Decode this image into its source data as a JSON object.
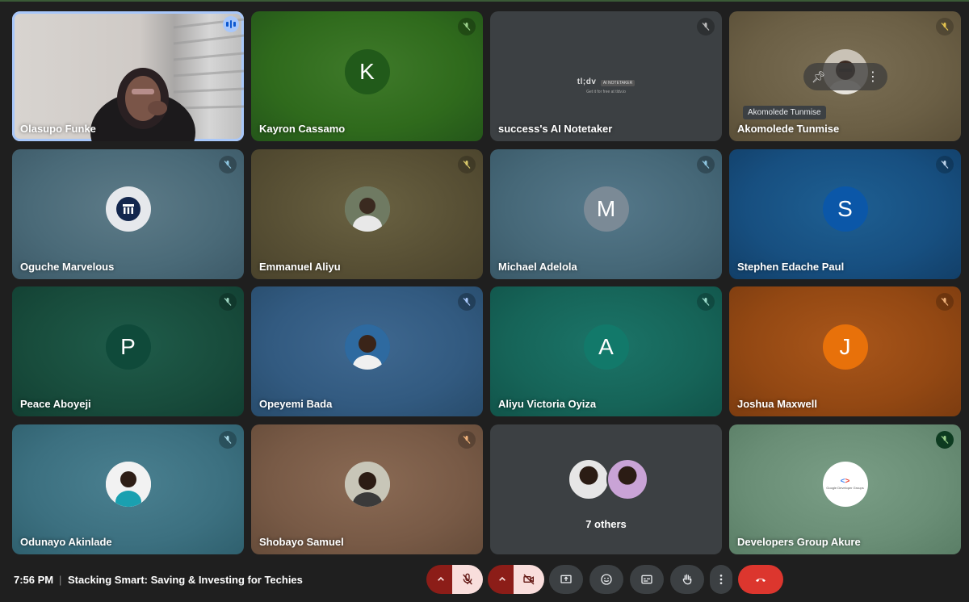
{
  "participants": [
    {
      "name": "Olasupo Funke"
    },
    {
      "name": "Kayron Cassamo",
      "initial": "K"
    },
    {
      "name": "success's AI Notetaker",
      "logo_text": "tl;dv",
      "logo_badge": "AI NOTETAKER",
      "logo_sub": "Get it for free at tldv.io"
    },
    {
      "name": "Akomolede Tunmise",
      "tooltip": "Akomolede Tunmise"
    },
    {
      "name": "Oguche Marvelous"
    },
    {
      "name": "Emmanuel Aliyu"
    },
    {
      "name": "Michael Adelola",
      "initial": "M"
    },
    {
      "name": "Stephen Edache Paul",
      "initial": "S"
    },
    {
      "name": "Peace Aboyeji",
      "initial": "P"
    },
    {
      "name": "Opeyemi Bada"
    },
    {
      "name": "Aliyu Victoria Oyiza",
      "initial": "A"
    },
    {
      "name": "Joshua Maxwell",
      "initial": "J"
    },
    {
      "name": "Odunayo Akinlade"
    },
    {
      "name": "Shobayo Samuel"
    },
    {
      "name": "7 others"
    },
    {
      "name": "Developers Group Akure",
      "logo_text": "Google Developer Groups"
    }
  ],
  "bottom_bar": {
    "time": "7:56 PM",
    "separator": "|",
    "meeting_title": "Stacking Smart: Saving & Investing for Techies"
  },
  "colors": {
    "speaking_outline": "#a8c7fa",
    "hangup": "#dc362e",
    "muted_control": "#f9dedc",
    "muted_arrow": "#8c1d18"
  },
  "icons": [
    "mic-off-icon",
    "pin-icon",
    "more-vert-icon",
    "chevron-up-icon",
    "camera-off-icon",
    "present-icon",
    "emoji-icon",
    "captions-icon",
    "hand-icon",
    "call-end-icon"
  ]
}
